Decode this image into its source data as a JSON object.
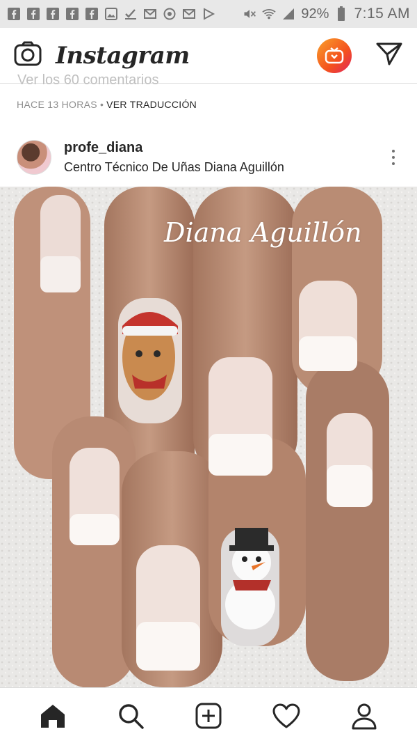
{
  "status_bar": {
    "battery": "92%",
    "time": "7:15 AM",
    "icons": [
      "facebook-icon",
      "facebook-icon",
      "facebook-icon",
      "facebook-icon",
      "facebook-icon",
      "gallery-icon",
      "check-icon",
      "mail-icon",
      "sync-icon",
      "gmail-icon",
      "play-icon",
      "mute-icon",
      "wifi-icon",
      "signal-icon",
      "battery-icon"
    ]
  },
  "top_nav": {
    "title": "Instagram",
    "icons": [
      "camera-icon",
      "igtv-icon",
      "direct-message-icon"
    ]
  },
  "previous_post": {
    "comments_link": "Ver los 60 comentarios",
    "time": "HACE 13 HORAS",
    "separator": "•",
    "translate_link": "VER TRADUCCIÓN"
  },
  "post": {
    "username": "profe_diana",
    "location": "Centro Técnico De Uñas Diana Aguillón",
    "watermark": "Diana Aguillón"
  },
  "bottom_nav": {
    "items": [
      "home-icon",
      "search-icon",
      "new-post-icon",
      "activity-icon",
      "profile-icon"
    ]
  },
  "colors": {
    "igtv_gradient_start": "#f9a02b",
    "igtv_gradient_end": "#e0245e",
    "text": "#262626",
    "muted": "#8e8e8e"
  }
}
